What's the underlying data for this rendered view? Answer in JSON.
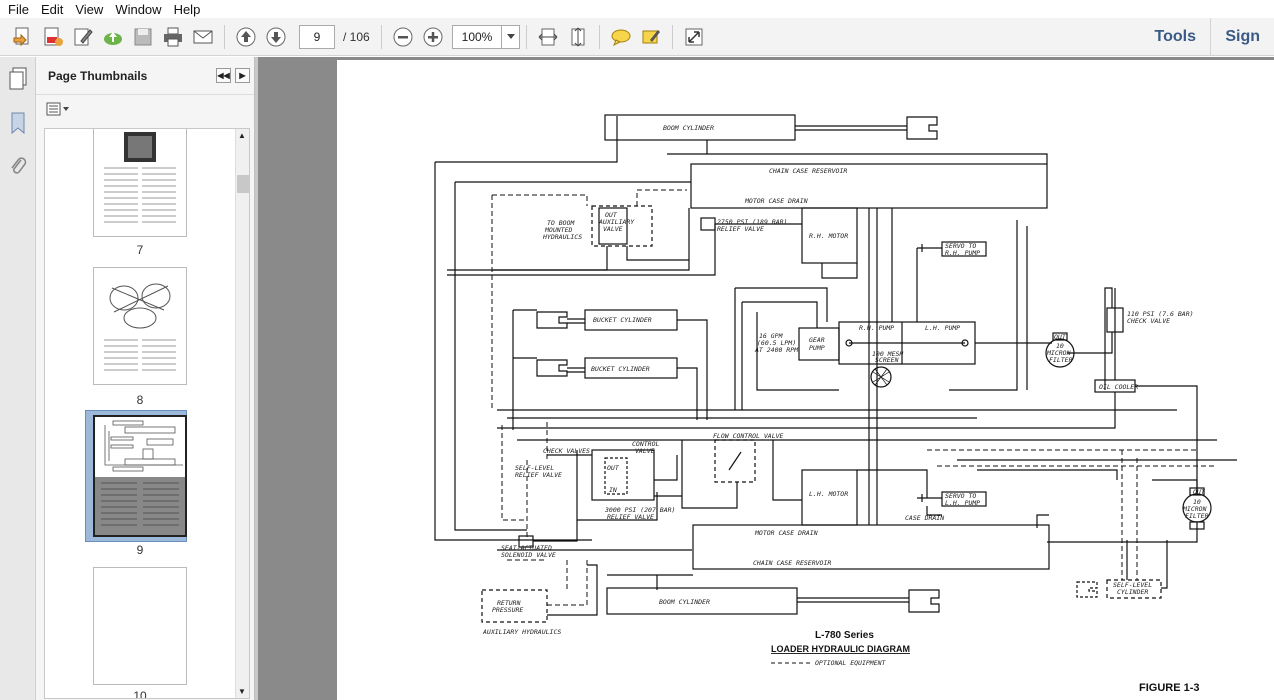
{
  "menu": {
    "items": [
      "File",
      "Edit",
      "View",
      "Window",
      "Help"
    ]
  },
  "toolbar": {
    "page_current": "9",
    "page_total": "/ 106",
    "zoom": "100%",
    "tools_label": "Tools",
    "sign_label": "Sign"
  },
  "thumbnails": {
    "title": "Page Thumbnails",
    "items": [
      {
        "label": "7"
      },
      {
        "label": "8"
      },
      {
        "label": "9"
      },
      {
        "label": "10"
      }
    ]
  },
  "diagram": {
    "labels": {
      "boom_top": "BOOM CYLINDER",
      "boom_bottom": "BOOM CYLINDER",
      "chain_top": "CHAIN CASE RESERVOIR",
      "chain_bottom": "CHAIN CASE RESERVOIR",
      "motor_drain_top": "MOTOR CASE DRAIN",
      "motor_drain_bottom": "MOTOR CASE DRAIN",
      "relief_2750": "2750 PSI (189 BAR)",
      "relief_valve": "RELIEF VALVE",
      "rh_motor": "R.H. MOTOR",
      "lh_motor": "L.H. MOTOR",
      "servo_rh_1": "SERVO TO",
      "servo_rh_2": "R.H. PUMP",
      "servo_lh_1": "SERVO TO",
      "servo_lh_2": "L.H. PUMP",
      "to_boom_1": "TO BOOM",
      "to_boom_2": "MOUNTED",
      "to_boom_3": "HYDRAULICS",
      "aux_valve_1": "OUT",
      "aux_valve_2": "AUXILIARY",
      "aux_valve_3": "VALVE",
      "bucket_top": "BUCKET CYLINDER",
      "bucket_bottom": "BUCKET CYLINDER",
      "rh_pump": "R.H. PUMP",
      "lh_pump": "L.H. PUMP",
      "gear_pump_1": "GEAR",
      "gear_pump_2": "PUMP",
      "gpm_1": "16 GPM",
      "gpm_2": "(60.5 LPM)",
      "gpm_3": "AT 2400 RPM",
      "mesh_1": "100 MESH",
      "mesh_2": "SCREEN",
      "check_110_1": "110 PSI (7.6 BAR)",
      "check_110_2": "CHECK VALVE",
      "filter_out": "OUT",
      "filter_10_1": "10",
      "filter_10_2": "MICRON",
      "filter_10_3": "FILTER",
      "oil_cooler": "OIL COOLER",
      "flow_control": "FLOW CONTROL VALVE",
      "control_valve_1": "CONTROL",
      "control_valve_2": "VALVE",
      "check_valves": "CHECK VALVES",
      "self_level_relief_1": "SELF-LEVEL",
      "self_level_relief_2": "RELIEF VALVE",
      "relief_3000_1": "3000 PSI (207 BAR)",
      "relief_3000_2": "RELIEF VALVE",
      "seat_1": "SEAT-ACTUATED",
      "seat_2": "SOLENOID VALVE",
      "case_drain": "CASE DRAIN",
      "return_1": "RETURN",
      "return_2": "PRESSURE",
      "aux_hyd": "AUXILIARY HYDRAULICS",
      "self_level_cyl_1": "SELF-LEVEL",
      "self_level_cyl_2": "CYLINDER",
      "out_label": "OUT",
      "in_label": "IN"
    },
    "series": "L-780 Series",
    "title": "LOADER HYDRAULIC DIAGRAM",
    "optional": "OPTIONAL EQUIPMENT",
    "figure": "FIGURE 1-3"
  },
  "colors": {
    "toolbar_bg": "#f3f3f3",
    "doc_bg": "#8a8a8a",
    "accent": "#3a5b85",
    "selected_thumb": "#9db9d9"
  }
}
